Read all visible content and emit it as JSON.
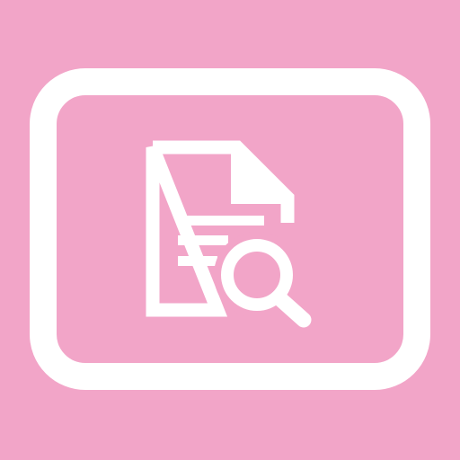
{
  "icon": {
    "name": "document-search-icon",
    "background_color": "#f2a5c8",
    "foreground_color": "#ffffff"
  }
}
